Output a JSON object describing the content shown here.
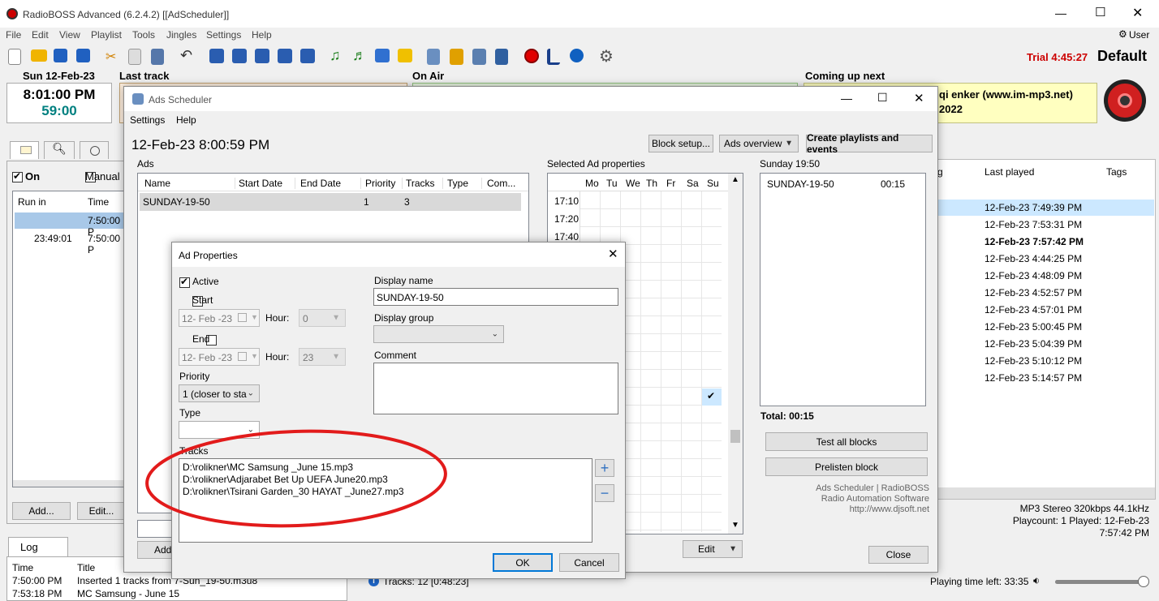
{
  "app": {
    "title": "RadioBOSS Advanced (6.2.4.2) [[AdScheduler]]",
    "user": "User",
    "trial": "Trial 4:45:27",
    "profile": "Default"
  },
  "menu": [
    "File",
    "Edit",
    "View",
    "Playlist",
    "Tools",
    "Jingles",
    "Settings",
    "Help"
  ],
  "clock": {
    "date": "Sun 12-Feb-23",
    "time": "8:01:00 PM",
    "seconds": "59:00"
  },
  "panels": {
    "last_track": "Last track",
    "on_air": "On Air",
    "coming_up": "Coming up next",
    "coming_line1": "qi enker (www.im-mp3.net)",
    "coming_line2": "2022"
  },
  "left": {
    "on_label": "On",
    "manual_label": "Manual",
    "col_run_in": "Run in",
    "col_time": "Time",
    "rows": [
      {
        "run_in": "",
        "time": "7:50:00 P"
      },
      {
        "run_in": "23:49:01",
        "time": "7:50:00 P"
      }
    ],
    "add_button": "Add...",
    "edit_button": "Edit..."
  },
  "log": {
    "tab": "Log",
    "col_time": "Time",
    "col_title": "Title",
    "rows": [
      {
        "time": "7:50:00 PM",
        "title": "Inserted 1 tracks from 7-Sun_19-50.m3u8"
      },
      {
        "time": "7:53:18 PM",
        "title": "MC Samsung - June 15"
      }
    ]
  },
  "playlist": {
    "col_partial": "g",
    "col_last_played": "Last played",
    "col_tags": "Tags",
    "last_played": [
      "12-Feb-23 7:49:39 PM",
      "12-Feb-23 7:53:31 PM",
      "12-Feb-23 7:57:42 PM",
      "12-Feb-23 4:44:25 PM",
      "12-Feb-23 4:48:09 PM",
      "12-Feb-23 4:52:57 PM",
      "12-Feb-23 4:57:01 PM",
      "12-Feb-23 5:00:45 PM",
      "12-Feb-23 5:04:39 PM",
      "12-Feb-23 5:10:12 PM",
      "12-Feb-23 5:14:57 PM"
    ],
    "info_format": "MP3 Stereo 320kbps 44.1kHz",
    "info_playcount": "Playcount: 1  Played: 12-Feb-23",
    "info_played_time": "7:57:42 PM",
    "tracks_status": "Tracks: 12 [0:48:23]",
    "playing_left": "Playing time left: 33:35"
  },
  "ads_scheduler": {
    "title": "Ads Scheduler",
    "menu": [
      "Settings",
      "Help"
    ],
    "datetime": "12-Feb-23 8:00:59 PM",
    "block_setup": "Block setup...",
    "ads_overview": "Ads overview",
    "create_btn": "Create playlists and events",
    "ads_label": "Ads",
    "columns": [
      "Name",
      "Start Date",
      "End Date",
      "Priority",
      "Tracks",
      "Type",
      "Com..."
    ],
    "row": {
      "name": "SUNDAY-19-50",
      "start": "",
      "end": "",
      "priority": "1",
      "tracks": "3",
      "type": "",
      "comment": ""
    },
    "selected_props": "Selected Ad properties",
    "days": [
      "Mo",
      "Tu",
      "We",
      "Th",
      "Fr",
      "Sa",
      "Su"
    ],
    "times": [
      "17:10",
      "17:20",
      "17:40"
    ],
    "edit_button": "Edit",
    "sunday_title": "Sunday 19:50",
    "sunday_item_name": "SUNDAY-19-50",
    "sunday_item_dur": "00:15",
    "total": "Total: 00:15",
    "test_all": "Test all blocks",
    "prelisten": "Prelisten block",
    "credit1": "Ads Scheduler | RadioBOSS",
    "credit2": "Radio Automation Software",
    "credit3": "http://www.djsoft.net",
    "close": "Close"
  },
  "ad_properties": {
    "title": "Ad Properties",
    "active_label": "Active",
    "active_checked": true,
    "start_label": "Start",
    "start_date": "12- Feb -23",
    "start_hour_label": "Hour:",
    "start_hour": "0",
    "end_label": "End",
    "end_date": "12- Feb -23",
    "end_hour_label": "Hour:",
    "end_hour": "23",
    "priority_label": "Priority",
    "priority_value": "1 (closer to sta",
    "type_label": "Type",
    "type_value": "",
    "display_name_label": "Display name",
    "display_name": "SUNDAY-19-50",
    "display_group_label": "Display group",
    "comment_label": "Comment",
    "tracks_label": "Tracks",
    "tracks": [
      "D:\\rolikner\\MC Samsung _June 15.mp3",
      "D:\\rolikner\\Adjarabet Bet Up UEFA June20.mp3",
      "D:\\rolikner\\Tsirani Garden_30 HAYAT _June27.mp3"
    ],
    "ok": "OK",
    "cancel": "Cancel"
  },
  "colors": {
    "selection_blue": "#cce8ff",
    "trial_red": "#cc0000",
    "clock_green": "#008080",
    "highlight_ellipse": "#e21b1b",
    "coming_yellow": "#ffffc0"
  }
}
